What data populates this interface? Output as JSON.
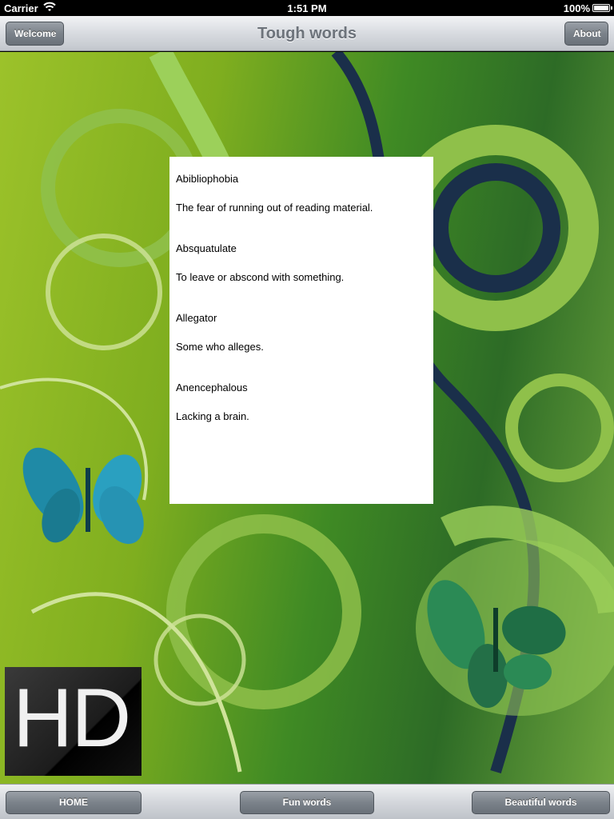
{
  "status": {
    "carrier": "Carrier",
    "time": "1:51 PM",
    "battery": "100%"
  },
  "nav": {
    "title": "Tough words",
    "left_button": "Welcome",
    "right_button": "About"
  },
  "entries": [
    {
      "word": "Abibliophobia",
      "definition": "The fear of running out of reading material."
    },
    {
      "word": "Absquatulate",
      "definition": "To leave or abscond with something."
    },
    {
      "word": "Allegator",
      "definition": "Some who alleges."
    },
    {
      "word": "Anencephalous",
      "definition": "Lacking a brain."
    }
  ],
  "logo": {
    "text": "HD"
  },
  "toolbar": {
    "home": "HOME",
    "fun": "Fun words",
    "beautiful": "Beautiful words"
  },
  "colors": {
    "background_green": "#7fae1f",
    "dark_green": "#2d6b26",
    "navy_accent": "#1a2f4a",
    "butterfly_blue": "#2a8fb5"
  }
}
